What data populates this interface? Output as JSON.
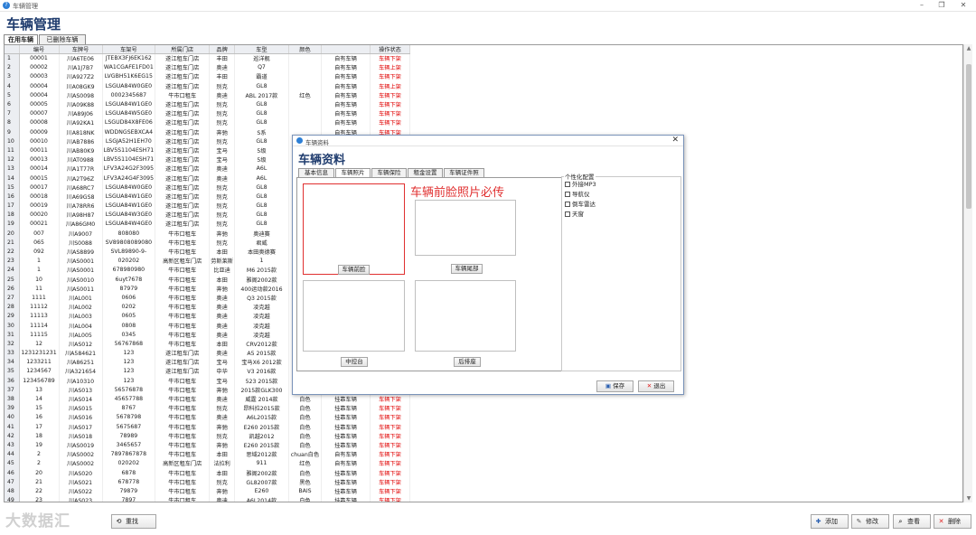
{
  "window": {
    "title": "车辆管理",
    "app_icon": "app-icon"
  },
  "page_title": "车辆管理",
  "tabs": [
    {
      "label": "在用车辆"
    },
    {
      "label": "已删除车辆"
    }
  ],
  "grid": {
    "columns": [
      "",
      "编号",
      "车牌号",
      "车架号",
      "所属门店",
      "品牌",
      "车型",
      "颜色",
      "",
      "操作状态"
    ],
    "rows": [
      [
        "1",
        "00001",
        "川A6TE06",
        "JTEBX3FJ6EK162",
        "遂江租车门店",
        "丰田",
        "巡洋舰",
        "",
        "自有车辆",
        "车辆下架"
      ],
      [
        "2",
        "00002",
        "川A1J7B7",
        "WA1CGAFE1FD01",
        "遂江租车门店",
        "奥迪",
        "Q7",
        "",
        "自有车辆",
        "车辆上架"
      ],
      [
        "3",
        "00003",
        "川A927Z2",
        "LVGBH51K6EG15",
        "遂江租车门店",
        "丰田",
        "霸道",
        "",
        "自有车辆",
        "车辆下架"
      ],
      [
        "4",
        "00004",
        "川A08GK9",
        "LSGUA84W0GE0",
        "遂江租车门店",
        "别克",
        "GL8",
        "",
        "自有车辆",
        "车辆上架"
      ],
      [
        "5",
        "00004",
        "川AS0098",
        "0002345687",
        "牛市口租车",
        "奥迪",
        "ABL 2017款",
        "红色",
        "自有车辆",
        "车辆下架"
      ],
      [
        "6",
        "00005",
        "川A09K88",
        "LSGUA84W1GE0",
        "遂江租车门店",
        "别克",
        "GL8",
        "",
        "自有车辆",
        "车辆下架"
      ],
      [
        "7",
        "00007",
        "川A89J06",
        "LSGUA84W5GE0",
        "遂江租车门店",
        "别克",
        "GL8",
        "",
        "自有车辆",
        "车辆下架"
      ],
      [
        "8",
        "00008",
        "川A92KA1",
        "LSGUD84X8FE06",
        "遂江租车门店",
        "别克",
        "GL8",
        "",
        "自有车辆",
        "车辆下架"
      ],
      [
        "9",
        "00009",
        "川A818NK",
        "WDDNGSEBXCA4",
        "遂江租车门店",
        "奔驰",
        "S系",
        "",
        "自有车辆",
        "车辆下架"
      ],
      [
        "10",
        "00010",
        "川AB7886",
        "LSGJA52H1EH70",
        "遂江租车门店",
        "别克",
        "GL8",
        "",
        "",
        ""
      ],
      [
        "11",
        "00011",
        "川AB80K9",
        "LBV5S1104ESH71",
        "遂江租车门店",
        "宝马",
        "5级",
        "",
        "",
        ""
      ],
      [
        "12",
        "00013",
        "川AT0988",
        "LBV5S1104ESH71",
        "遂江租车门店",
        "宝马",
        "5级",
        "",
        "",
        ""
      ],
      [
        "13",
        "00014",
        "川A1T77R",
        "LFV3A24G2F3095",
        "遂江租车门店",
        "奥迪",
        "A6L",
        "",
        "",
        ""
      ],
      [
        "14",
        "00015",
        "川A2T96Z",
        "LFV3A24G4F3095",
        "遂江租车门店",
        "奥迪",
        "A6L",
        "",
        "",
        ""
      ],
      [
        "15",
        "00017",
        "川A68RC7",
        "LSGUA84W0GE0",
        "遂江租车门店",
        "别克",
        "GL8",
        "",
        "",
        ""
      ],
      [
        "16",
        "00018",
        "川A69GS8",
        "LSGUA84W1GE0",
        "遂江租车门店",
        "别克",
        "GL8",
        "",
        "",
        ""
      ],
      [
        "17",
        "00019",
        "川A78RR6",
        "LSGUA84W1GE0",
        "遂江租车门店",
        "别克",
        "GL8",
        "",
        "",
        ""
      ],
      [
        "18",
        "00020",
        "川A98H87",
        "LSGUA84W3GE0",
        "遂江租车门店",
        "别克",
        "GL8",
        "",
        "",
        ""
      ],
      [
        "19",
        "00021",
        "川A86GM0",
        "LSGUA84W4GE0",
        "遂江租车门店",
        "别克",
        "GL8",
        "",
        "",
        ""
      ],
      [
        "20",
        "007",
        "川A9007",
        "808080",
        "牛市口租车",
        "奔驰",
        "奥迪赛",
        "",
        "",
        ""
      ],
      [
        "21",
        "065",
        "川S0088",
        "SV89808089080",
        "牛市口租车",
        "别克",
        "君威",
        "",
        "",
        ""
      ],
      [
        "22",
        "092",
        "川AS8899",
        "SVL89890-9-",
        "牛市口租车",
        "本田",
        "本田奥德赛",
        "",
        "",
        ""
      ],
      [
        "23",
        "1",
        "川AS0001",
        "020202",
        "高新区租车门店",
        "劳斯莱斯",
        "1",
        "",
        "",
        ""
      ],
      [
        "24",
        "1",
        "川AS0001",
        "678980980",
        "牛市口租车",
        "比亚迪",
        "M6 2015款",
        "",
        "",
        ""
      ],
      [
        "25",
        "10",
        "川AS0010",
        "6uyt7678",
        "牛市口租车",
        "本田",
        "雅阁2002款",
        "",
        "",
        ""
      ],
      [
        "26",
        "11",
        "川AS0011",
        "87979",
        "牛市口租车",
        "奔驰",
        "400运动款2016",
        "",
        "",
        ""
      ],
      [
        "27",
        "1111",
        "川AL001",
        "0606",
        "牛市口租车",
        "奥迪",
        "Q3 2015款",
        "",
        "",
        ""
      ],
      [
        "28",
        "11112",
        "川AL002",
        "0202",
        "牛市口租车",
        "奥迪",
        "凌克越",
        "",
        "",
        ""
      ],
      [
        "29",
        "11113",
        "川AL003",
        "0605",
        "牛市口租车",
        "奥迪",
        "凌克越",
        "",
        "",
        ""
      ],
      [
        "30",
        "11114",
        "川AL004",
        "0808",
        "牛市口租车",
        "奥迪",
        "凌克越",
        "",
        "",
        ""
      ],
      [
        "31",
        "11115",
        "川AL005",
        "0345",
        "牛市口租车",
        "奥迪",
        "凌克越",
        "",
        "",
        ""
      ],
      [
        "32",
        "12",
        "川AS012",
        "56767868",
        "牛市口租车",
        "本田",
        "CRV2012款",
        "",
        "",
        ""
      ],
      [
        "33",
        "1231231231",
        "川A584621",
        "123",
        "遂江租车门店",
        "奥迪",
        "A5 2015款",
        "",
        "",
        ""
      ],
      [
        "34",
        "1233211",
        "川A86251",
        "123",
        "遂江租车门店",
        "宝马",
        "宝马X6 2012款",
        "",
        "",
        ""
      ],
      [
        "35",
        "1234567",
        "川A321654",
        "123",
        "遂江租车门店",
        "中华",
        "V3 2016款",
        "",
        "",
        ""
      ],
      [
        "36",
        "123456789",
        "川A10310",
        "123",
        "牛市口租车",
        "宝马",
        "523 2015款",
        "",
        "",
        ""
      ],
      [
        "37",
        "13",
        "川AS013",
        "56576878",
        "牛市口租车",
        "奔驰",
        "2015款GLK300",
        "",
        "",
        ""
      ],
      [
        "38",
        "14",
        "川AS014",
        "45657788",
        "牛市口租车",
        "奥迪",
        "威霆 2014款",
        "白色",
        "挂靠车辆",
        "车辆下架"
      ],
      [
        "39",
        "15",
        "川AS015",
        "8767",
        "牛市口租车",
        "别克",
        "昂科拉2015款",
        "白色",
        "挂靠车辆",
        "车辆下架"
      ],
      [
        "40",
        "16",
        "川AS016",
        "5678798",
        "牛市口租车",
        "奥迪",
        "A6L2015款",
        "白色",
        "挂靠车辆",
        "车辆下架"
      ],
      [
        "41",
        "17",
        "川AS017",
        "5675687",
        "牛市口租车",
        "奔驰",
        "E260 2015款",
        "白色",
        "挂靠车辆",
        "车辆下架"
      ],
      [
        "42",
        "18",
        "川AS018",
        "78989",
        "牛市口租车",
        "别克",
        "凯越2012",
        "白色",
        "挂靠车辆",
        "车辆下架"
      ],
      [
        "43",
        "19",
        "川AS0019",
        "3465657",
        "牛市口租车",
        "奔驰",
        "E260 2015款",
        "白色",
        "挂靠车辆",
        "车辆下架"
      ],
      [
        "44",
        "2",
        "川AS0002",
        "7897867878",
        "牛市口租车",
        "本田",
        "思域2012款",
        "chuan白色",
        "自有车辆",
        "车辆下架"
      ],
      [
        "45",
        "2",
        "川AS0002",
        "020202",
        "高新区租车门店",
        "法拉利",
        "911",
        "红色",
        "自有车辆",
        "车辆下架"
      ],
      [
        "46",
        "20",
        "川AS020",
        "6878",
        "牛市口租车",
        "本田",
        "雅阁2002款",
        "白色",
        "挂靠车辆",
        "车辆下架"
      ],
      [
        "47",
        "21",
        "川AS021",
        "678778",
        "牛市口租车",
        "别克",
        "GL82007款",
        "黑色",
        "挂靠车辆",
        "车辆下架"
      ],
      [
        "48",
        "22",
        "川AS022",
        "79879",
        "牛市口租车",
        "奔驰",
        "E260",
        "BAIS",
        "挂靠车辆",
        "车辆下架"
      ],
      [
        "49",
        "23",
        "川AS023",
        "7897",
        "牛市口租车",
        "奥迪",
        "A6L2014款",
        "白色",
        "挂靠车辆",
        "车辆下架"
      ]
    ]
  },
  "dialog": {
    "header": "车辆资料",
    "title": "车辆资料",
    "close_label": "✕",
    "tabs": [
      {
        "label": "基本信息"
      },
      {
        "label": "车辆照片"
      },
      {
        "label": "车辆保险"
      },
      {
        "label": "租金设置"
      },
      {
        "label": "车辆证件照"
      }
    ],
    "photo_buttons": [
      {
        "label": "车辆前脸"
      },
      {
        "label": "车辆尾部"
      },
      {
        "label": "中控台"
      },
      {
        "label": "后排座"
      }
    ],
    "note": "车辆前脸照片必传",
    "config": {
      "legend": "个性化配置",
      "options": [
        {
          "label": "外接MP3"
        },
        {
          "label": "导航仪"
        },
        {
          "label": "倒车雷达"
        },
        {
          "label": "天窗"
        }
      ]
    },
    "save_label": "保存",
    "exit_label": "退出"
  },
  "bottom": {
    "left_label": "重找",
    "add_label": "添加",
    "edit_label": "修改",
    "view_label": "查看",
    "delete_label": "删除"
  },
  "watermark": "大数据汇"
}
